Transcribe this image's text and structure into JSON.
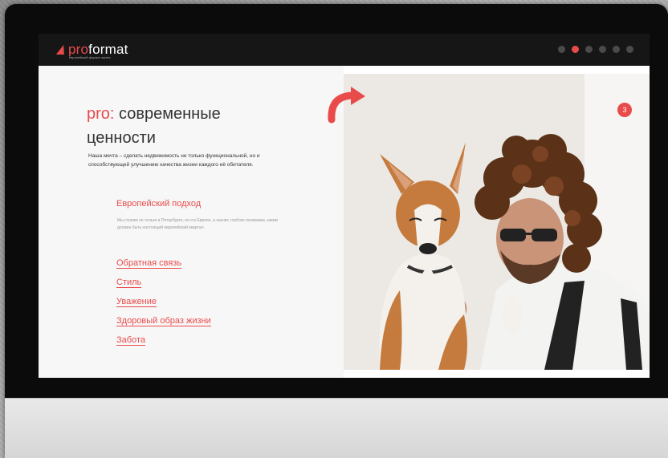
{
  "brand": {
    "logo_prefix": "pro",
    "logo_suffix": "format",
    "tagline": "европейский формат жизни"
  },
  "pagination": {
    "total": 6,
    "active_index": 1
  },
  "hero": {
    "headline_prefix": "pro:",
    "headline_line1": "современные",
    "headline_line2": "ценности",
    "description": "Наша мечта – сделать недвижимость не только функциональной, но и способствующей улучшению качества жизни каждого её обитателя."
  },
  "section": {
    "title": "Европейский подход",
    "text": "Мы строим не только в Петербурге, но и в Европе, а значит, глубоко понимаем, каким должен быть настоящий европейский квартал."
  },
  "values_links": [
    "Обратная связь",
    "Стиль",
    "Уважение",
    "Здоровый образ жизни",
    "Забота"
  ],
  "slide_badge": "3",
  "colors": {
    "accent": "#e94b4b",
    "topbar": "#161616",
    "text": "#333333"
  },
  "icons": [
    "curved-arrow-icon",
    "logo-mark-icon"
  ]
}
